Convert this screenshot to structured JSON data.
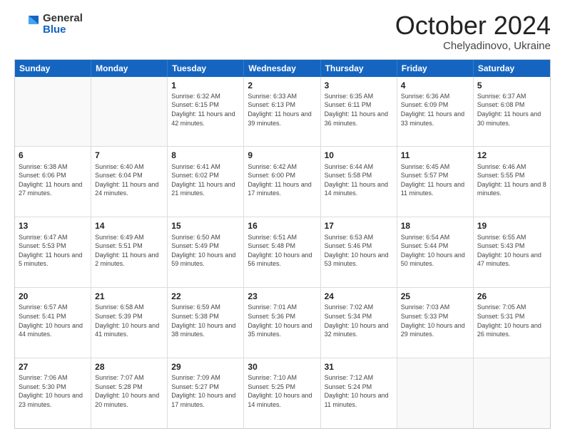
{
  "logo": {
    "general": "General",
    "blue": "Blue"
  },
  "header": {
    "month": "October 2024",
    "location": "Chelyadinovo, Ukraine"
  },
  "weekdays": [
    "Sunday",
    "Monday",
    "Tuesday",
    "Wednesday",
    "Thursday",
    "Friday",
    "Saturday"
  ],
  "rows": [
    [
      {
        "day": "",
        "info": ""
      },
      {
        "day": "",
        "info": ""
      },
      {
        "day": "1",
        "info": "Sunrise: 6:32 AM\nSunset: 6:15 PM\nDaylight: 11 hours and 42 minutes."
      },
      {
        "day": "2",
        "info": "Sunrise: 6:33 AM\nSunset: 6:13 PM\nDaylight: 11 hours and 39 minutes."
      },
      {
        "day": "3",
        "info": "Sunrise: 6:35 AM\nSunset: 6:11 PM\nDaylight: 11 hours and 36 minutes."
      },
      {
        "day": "4",
        "info": "Sunrise: 6:36 AM\nSunset: 6:09 PM\nDaylight: 11 hours and 33 minutes."
      },
      {
        "day": "5",
        "info": "Sunrise: 6:37 AM\nSunset: 6:08 PM\nDaylight: 11 hours and 30 minutes."
      }
    ],
    [
      {
        "day": "6",
        "info": "Sunrise: 6:38 AM\nSunset: 6:06 PM\nDaylight: 11 hours and 27 minutes."
      },
      {
        "day": "7",
        "info": "Sunrise: 6:40 AM\nSunset: 6:04 PM\nDaylight: 11 hours and 24 minutes."
      },
      {
        "day": "8",
        "info": "Sunrise: 6:41 AM\nSunset: 6:02 PM\nDaylight: 11 hours and 21 minutes."
      },
      {
        "day": "9",
        "info": "Sunrise: 6:42 AM\nSunset: 6:00 PM\nDaylight: 11 hours and 17 minutes."
      },
      {
        "day": "10",
        "info": "Sunrise: 6:44 AM\nSunset: 5:58 PM\nDaylight: 11 hours and 14 minutes."
      },
      {
        "day": "11",
        "info": "Sunrise: 6:45 AM\nSunset: 5:57 PM\nDaylight: 11 hours and 11 minutes."
      },
      {
        "day": "12",
        "info": "Sunrise: 6:46 AM\nSunset: 5:55 PM\nDaylight: 11 hours and 8 minutes."
      }
    ],
    [
      {
        "day": "13",
        "info": "Sunrise: 6:47 AM\nSunset: 5:53 PM\nDaylight: 11 hours and 5 minutes."
      },
      {
        "day": "14",
        "info": "Sunrise: 6:49 AM\nSunset: 5:51 PM\nDaylight: 11 hours and 2 minutes."
      },
      {
        "day": "15",
        "info": "Sunrise: 6:50 AM\nSunset: 5:49 PM\nDaylight: 10 hours and 59 minutes."
      },
      {
        "day": "16",
        "info": "Sunrise: 6:51 AM\nSunset: 5:48 PM\nDaylight: 10 hours and 56 minutes."
      },
      {
        "day": "17",
        "info": "Sunrise: 6:53 AM\nSunset: 5:46 PM\nDaylight: 10 hours and 53 minutes."
      },
      {
        "day": "18",
        "info": "Sunrise: 6:54 AM\nSunset: 5:44 PM\nDaylight: 10 hours and 50 minutes."
      },
      {
        "day": "19",
        "info": "Sunrise: 6:55 AM\nSunset: 5:43 PM\nDaylight: 10 hours and 47 minutes."
      }
    ],
    [
      {
        "day": "20",
        "info": "Sunrise: 6:57 AM\nSunset: 5:41 PM\nDaylight: 10 hours and 44 minutes."
      },
      {
        "day": "21",
        "info": "Sunrise: 6:58 AM\nSunset: 5:39 PM\nDaylight: 10 hours and 41 minutes."
      },
      {
        "day": "22",
        "info": "Sunrise: 6:59 AM\nSunset: 5:38 PM\nDaylight: 10 hours and 38 minutes."
      },
      {
        "day": "23",
        "info": "Sunrise: 7:01 AM\nSunset: 5:36 PM\nDaylight: 10 hours and 35 minutes."
      },
      {
        "day": "24",
        "info": "Sunrise: 7:02 AM\nSunset: 5:34 PM\nDaylight: 10 hours and 32 minutes."
      },
      {
        "day": "25",
        "info": "Sunrise: 7:03 AM\nSunset: 5:33 PM\nDaylight: 10 hours and 29 minutes."
      },
      {
        "day": "26",
        "info": "Sunrise: 7:05 AM\nSunset: 5:31 PM\nDaylight: 10 hours and 26 minutes."
      }
    ],
    [
      {
        "day": "27",
        "info": "Sunrise: 7:06 AM\nSunset: 5:30 PM\nDaylight: 10 hours and 23 minutes."
      },
      {
        "day": "28",
        "info": "Sunrise: 7:07 AM\nSunset: 5:28 PM\nDaylight: 10 hours and 20 minutes."
      },
      {
        "day": "29",
        "info": "Sunrise: 7:09 AM\nSunset: 5:27 PM\nDaylight: 10 hours and 17 minutes."
      },
      {
        "day": "30",
        "info": "Sunrise: 7:10 AM\nSunset: 5:25 PM\nDaylight: 10 hours and 14 minutes."
      },
      {
        "day": "31",
        "info": "Sunrise: 7:12 AM\nSunset: 5:24 PM\nDaylight: 10 hours and 11 minutes."
      },
      {
        "day": "",
        "info": ""
      },
      {
        "day": "",
        "info": ""
      }
    ]
  ]
}
